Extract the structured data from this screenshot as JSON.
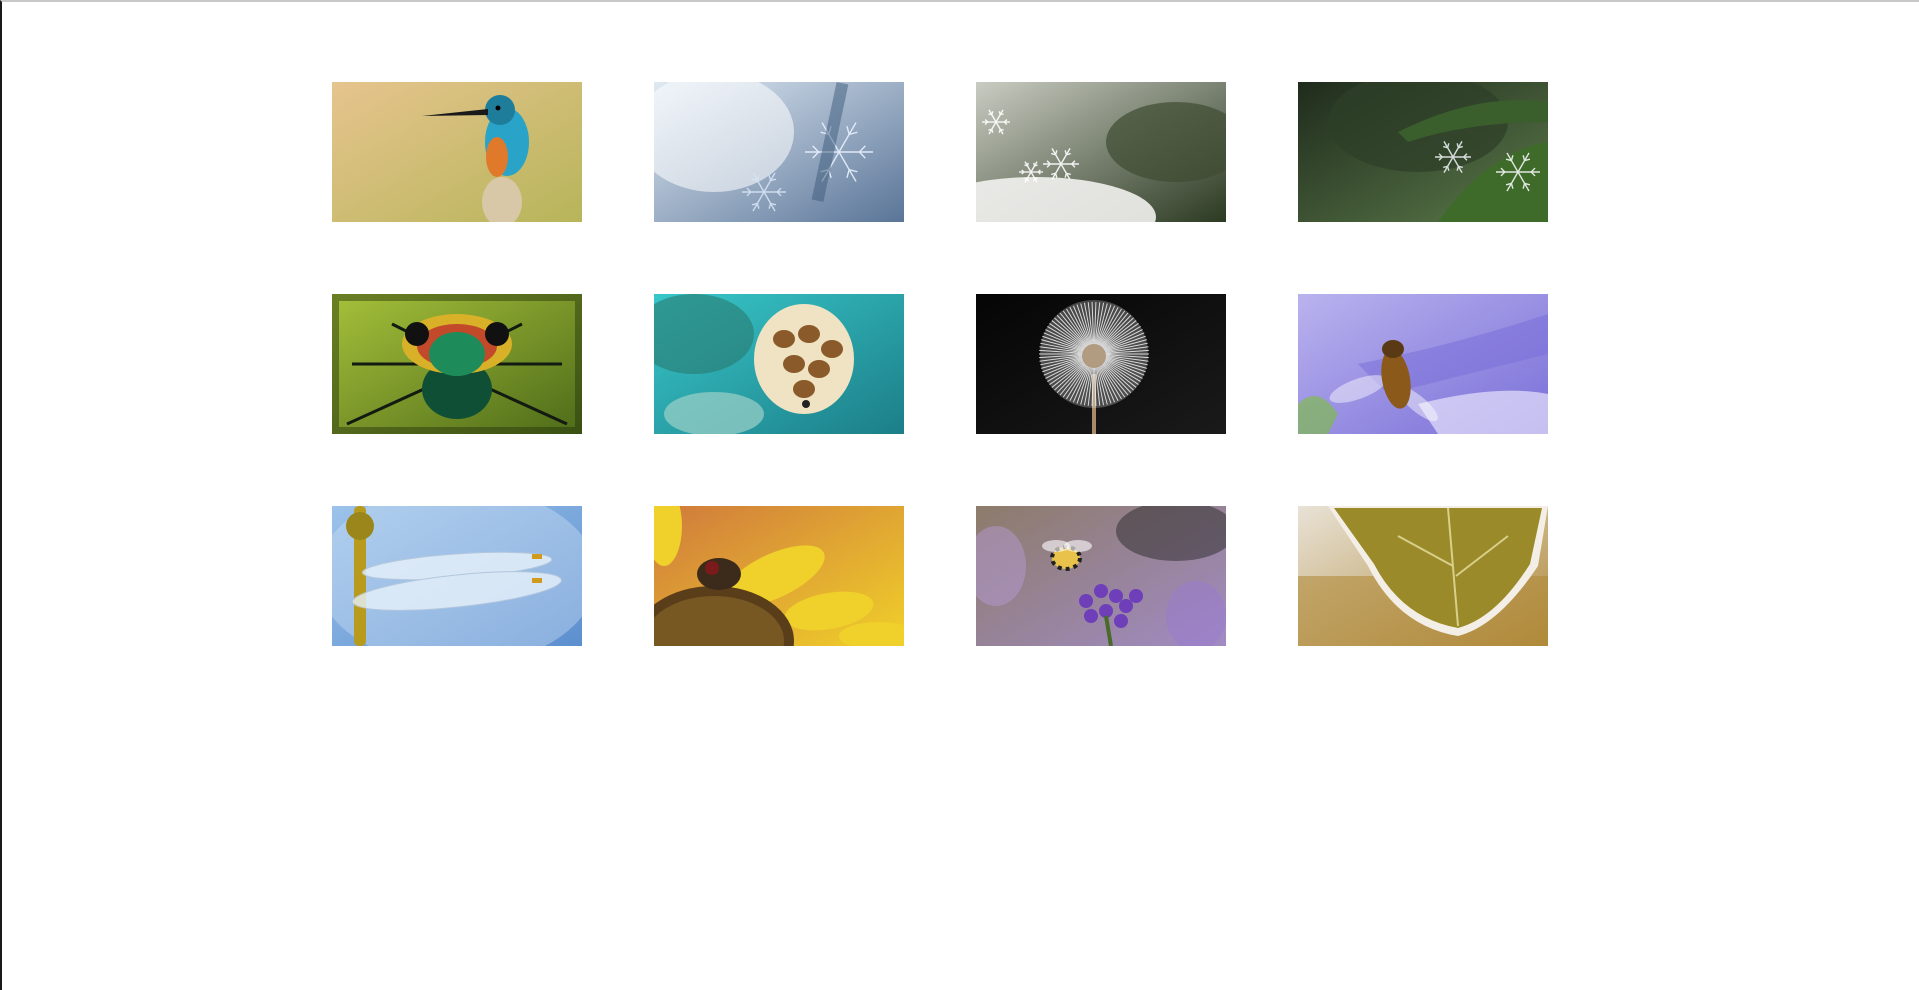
{
  "gallery": {
    "thumbnails": [
      {
        "subject": "kingfisher",
        "icon": "kingfisher-photo",
        "colors": {
          "bg1": "#e6c48e",
          "bg2": "#b7b55a",
          "accent": "#2aa3c8",
          "accent2": "#e07a2a"
        }
      },
      {
        "subject": "snowflakes-blue",
        "icon": "snowflake-photo",
        "colors": {
          "bg1": "#dfe9f3",
          "bg2": "#5a7598",
          "accent": "#ffffff",
          "accent2": "#3b5a7a"
        }
      },
      {
        "subject": "snowflakes-green",
        "icon": "snowflake-photo",
        "colors": {
          "bg1": "#c9ccc2",
          "bg2": "#2c3a22",
          "accent": "#ffffff",
          "accent2": "#6e7a5e"
        }
      },
      {
        "subject": "frost-leaf",
        "icon": "frost-leaf-photo",
        "colors": {
          "bg1": "#1f2b1c",
          "bg2": "#5b7a4a",
          "accent": "#e8eef0",
          "accent2": "#3b5e2d"
        }
      },
      {
        "subject": "beetle",
        "icon": "beetle-photo",
        "colors": {
          "bg1": "#a6c13a",
          "bg2": "#4e6b19",
          "accent": "#1e8c5a",
          "accent2": "#d8b128"
        }
      },
      {
        "subject": "sea-turtle",
        "icon": "turtle-photo",
        "colors": {
          "bg1": "#38c7c9",
          "bg2": "#1c7e88",
          "accent": "#8a5a2a",
          "accent2": "#f2e7cf"
        }
      },
      {
        "subject": "dandelion",
        "icon": "dandelion-photo",
        "colors": {
          "bg1": "#050505",
          "bg2": "#1a1a1a",
          "accent": "#efefef",
          "accent2": "#a88c6a"
        }
      },
      {
        "subject": "hoverfly",
        "icon": "hoverfly-photo",
        "colors": {
          "bg1": "#b9b3ee",
          "bg2": "#7a6fd8",
          "accent": "#8b5a1a",
          "accent2": "#e6e2fb"
        }
      },
      {
        "subject": "dragonfly",
        "icon": "dragonfly-photo",
        "colors": {
          "bg1": "#9cc3ea",
          "bg2": "#5c8fcf",
          "accent": "#b89a1c",
          "accent2": "#e8f2fb"
        }
      },
      {
        "subject": "fly-on-sunflower",
        "icon": "fly-photo",
        "colors": {
          "bg1": "#d07a3c",
          "bg2": "#f0d02a",
          "accent": "#3c2a1a",
          "accent2": "#e6c23a"
        }
      },
      {
        "subject": "bee-lavender",
        "icon": "bee-photo",
        "colors": {
          "bg1": "#8d7b6a",
          "bg2": "#a18bc4",
          "accent": "#6e3fb8",
          "accent2": "#e8c24a"
        }
      },
      {
        "subject": "frosted-leaf",
        "icon": "frosted-leaf-photo",
        "colors": {
          "bg1": "#e8e2d6",
          "bg2": "#b08a3a",
          "accent": "#9a8a2a",
          "accent2": "#f4efe6"
        }
      }
    ]
  }
}
